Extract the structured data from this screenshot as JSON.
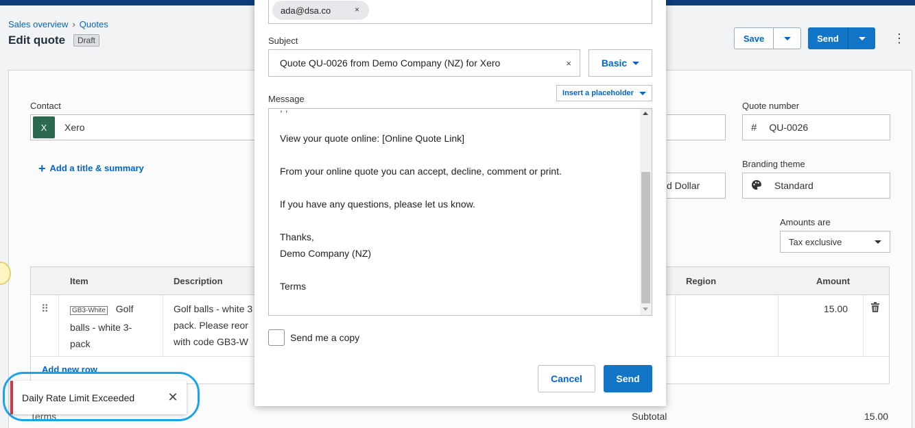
{
  "breadcrumb": {
    "parent": "Sales overview",
    "separator": "›",
    "current": "Quotes"
  },
  "page": {
    "title": "Edit quote",
    "status_badge": "Draft"
  },
  "toolbar": {
    "save_label": "Save",
    "send_label": "Send",
    "more_icon": "⋮"
  },
  "form": {
    "contact_label": "Contact",
    "contact_initial": "X",
    "contact_value": "Xero",
    "add_title_label": "Add a title & summary",
    "quote_number_label": "Quote number",
    "quote_number_prefix": "#",
    "quote_number_value": "QU-0026",
    "currency_partial": "d Dollar",
    "branding_label": "Branding theme",
    "branding_value": "Standard",
    "amounts_label": "Amounts are",
    "amounts_value": "Tax exclusive"
  },
  "table": {
    "headers": {
      "item": "Item",
      "description": "Description",
      "region": "Region",
      "amount": "Amount"
    },
    "row": {
      "item_code": "GB3-White",
      "item_name_line1": "Golf",
      "item_name_line2": "balls - white 3-",
      "item_name_line3": "pack",
      "desc_line1": "Golf balls - white 3",
      "desc_line2": "pack. Please reor",
      "desc_line3": "with code GB3-W",
      "amount": "15.00"
    },
    "add_row_label": "Add new row"
  },
  "totals": {
    "subtotal_label": "Subtotal",
    "subtotal_value": "15.00",
    "terms_partial": "Terms"
  },
  "toast": {
    "message": "Daily Rate Limit Exceeded",
    "close_icon": "✕"
  },
  "modal": {
    "recipient_chip": "ada@dsa.co",
    "chip_remove": "×",
    "subject_label": "Subject",
    "subject_value": "Quote QU-0026 from Demo Company (NZ) for Xero",
    "subject_clear": "×",
    "template_button": "Basic",
    "message_label": "Message",
    "placeholder_button": "Insert a placeholder",
    "message_lines": {
      "l1": "View your quote online: [Online Quote Link]",
      "l2": "From your online quote you can accept, decline, comment or print.",
      "l3": "If you have any questions, please let us know.",
      "l4": "Thanks,",
      "l5": "Demo Company (NZ)",
      "l6": "Terms"
    },
    "send_copy_label": "Send me a copy",
    "send_copy_checked": false,
    "cancel_label": "Cancel",
    "send_label": "Send"
  },
  "colors": {
    "accent": "#1375c8",
    "link": "#0066cc",
    "error": "#cc3b4a",
    "highlight_ring": "#1aa3e8",
    "topbar": "#0a3d7a"
  }
}
